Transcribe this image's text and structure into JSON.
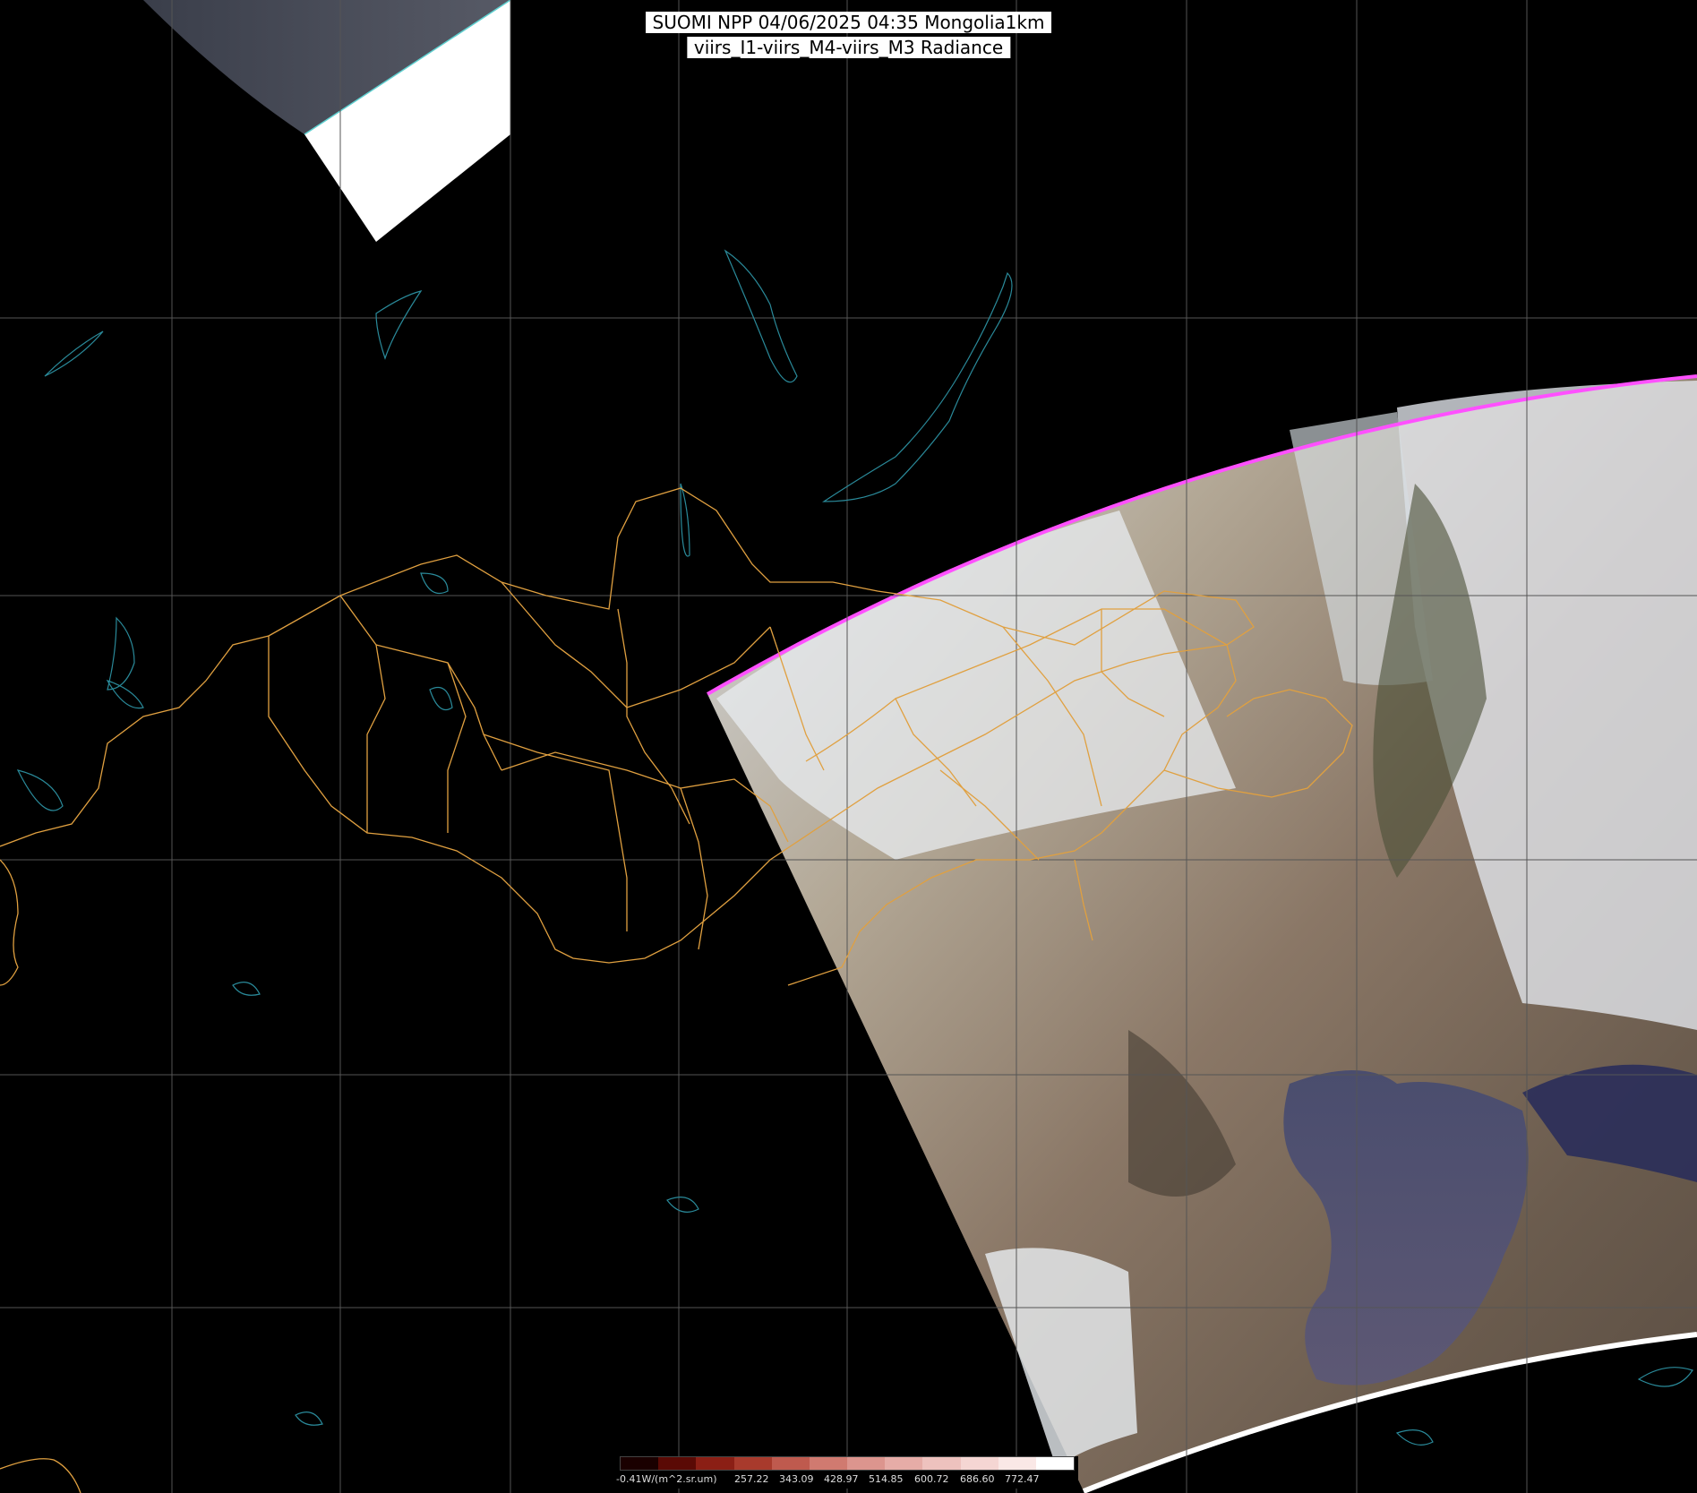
{
  "title": {
    "line1": "SUOMI NPP 04/06/2025 04:35 Mongolia1km",
    "line2": "viirs_I1-viirs_M4-viirs_M3 Radiance"
  },
  "legend": {
    "unit_label": "-0.41W/(m^2.sr.um)",
    "ticks": [
      "257.22",
      "343.09",
      "428.97",
      "514.85",
      "600.72",
      "686.60",
      "772.47"
    ],
    "colors": [
      "#1a0000",
      "#5a0a05",
      "#8b1f15",
      "#a83a2c",
      "#bf5a4e",
      "#d07a70",
      "#dc958e",
      "#e6aca7",
      "#eec2be",
      "#f5d6d3",
      "#fae8e6",
      "#ffffff"
    ]
  },
  "colors": {
    "background": "#000000",
    "grid": "#555555",
    "borders": "#e0a040",
    "water_outline": "#2a8a9a",
    "swath_edge": "#ff50ff"
  }
}
